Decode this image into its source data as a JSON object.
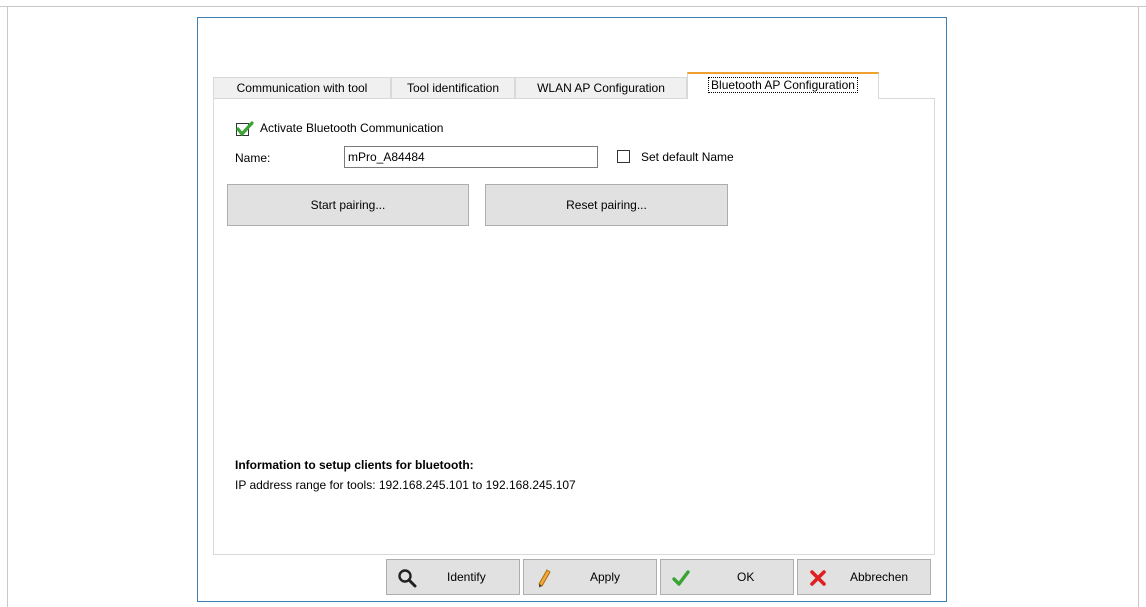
{
  "tabs": [
    {
      "label": "Communication with tool"
    },
    {
      "label": "Tool identification"
    },
    {
      "label": "WLAN AP Configuration"
    },
    {
      "label": "Bluetooth AP Configuration"
    }
  ],
  "bluetooth": {
    "activate_label": "Activate Bluetooth Communication",
    "activate_checked": true,
    "name_label": "Name:",
    "name_value": "mPro_A84484",
    "set_default_label": "Set default Name",
    "set_default_checked": false,
    "start_pairing_label": "Start pairing...",
    "reset_pairing_label": "Reset pairing...",
    "info_heading": "Information to setup clients for bluetooth:",
    "info_text": "IP address range for tools: 192.168.245.101 to 192.168.245.107"
  },
  "footer": {
    "identify_label": "Identify",
    "apply_label": "Apply",
    "ok_label": "OK",
    "cancel_label": "Abbrechen"
  },
  "colors": {
    "accent_tab": "#f0a030",
    "check_green": "#3aa335",
    "cancel_red": "#e02020",
    "dialog_border": "#3c7fb1"
  },
  "icons": {
    "identify": "magnifier-icon",
    "apply": "pencil-icon",
    "ok": "checkmark-icon",
    "cancel": "cross-icon"
  }
}
